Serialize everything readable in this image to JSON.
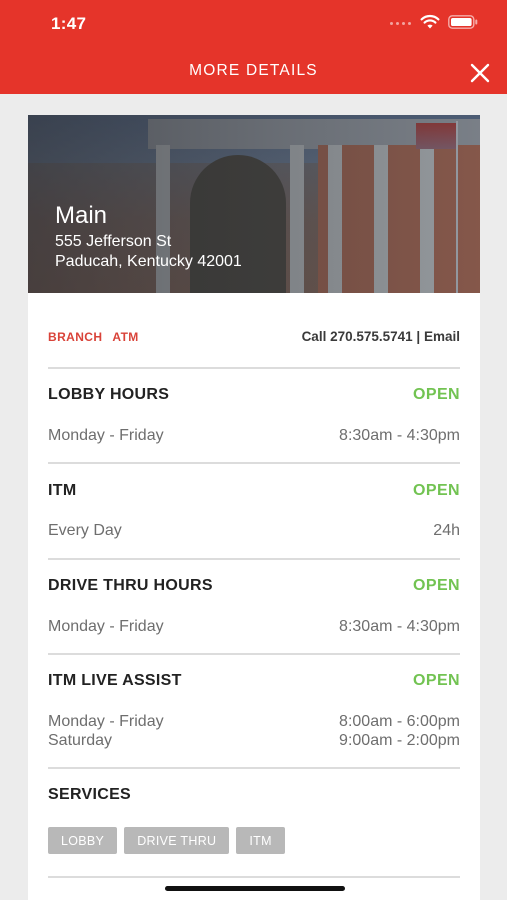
{
  "status_bar": {
    "time": "1:47"
  },
  "header": {
    "title": "MORE DETAILS",
    "close_icon": "close-icon"
  },
  "location": {
    "name": "Main",
    "address_line1": "555 Jefferson St",
    "address_line2": "Paducah, Kentucky 42001"
  },
  "types": [
    "BRANCH",
    "ATM"
  ],
  "contact": {
    "call_text": "Call 270.575.5741",
    "separator": "|",
    "email_text": "Email"
  },
  "sections": [
    {
      "title": "LOBBY HOURS",
      "status": "OPEN",
      "rows": [
        {
          "label": "Monday - Friday",
          "value": "8:30am - 4:30pm"
        }
      ]
    },
    {
      "title": "ITM",
      "status": "OPEN",
      "rows": [
        {
          "label": "Every Day",
          "value": "24h"
        }
      ]
    },
    {
      "title": "DRIVE THRU HOURS",
      "status": "OPEN",
      "rows": [
        {
          "label": "Monday - Friday",
          "value": "8:30am - 4:30pm"
        }
      ]
    },
    {
      "title": "ITM LIVE ASSIST",
      "status": "OPEN",
      "rows": [
        {
          "label": "Monday - Friday",
          "value": "8:00am - 6:00pm"
        },
        {
          "label": "Saturday",
          "value": "9:00am - 2:00pm"
        }
      ]
    }
  ],
  "services": {
    "title": "SERVICES",
    "items": [
      "LOBBY",
      "DRIVE THRU",
      "ITM"
    ]
  },
  "colors": {
    "header_bg": "#e5342a",
    "accent_red": "#d94339",
    "open_green": "#72c352",
    "chip_bg": "#b8b8b8"
  }
}
